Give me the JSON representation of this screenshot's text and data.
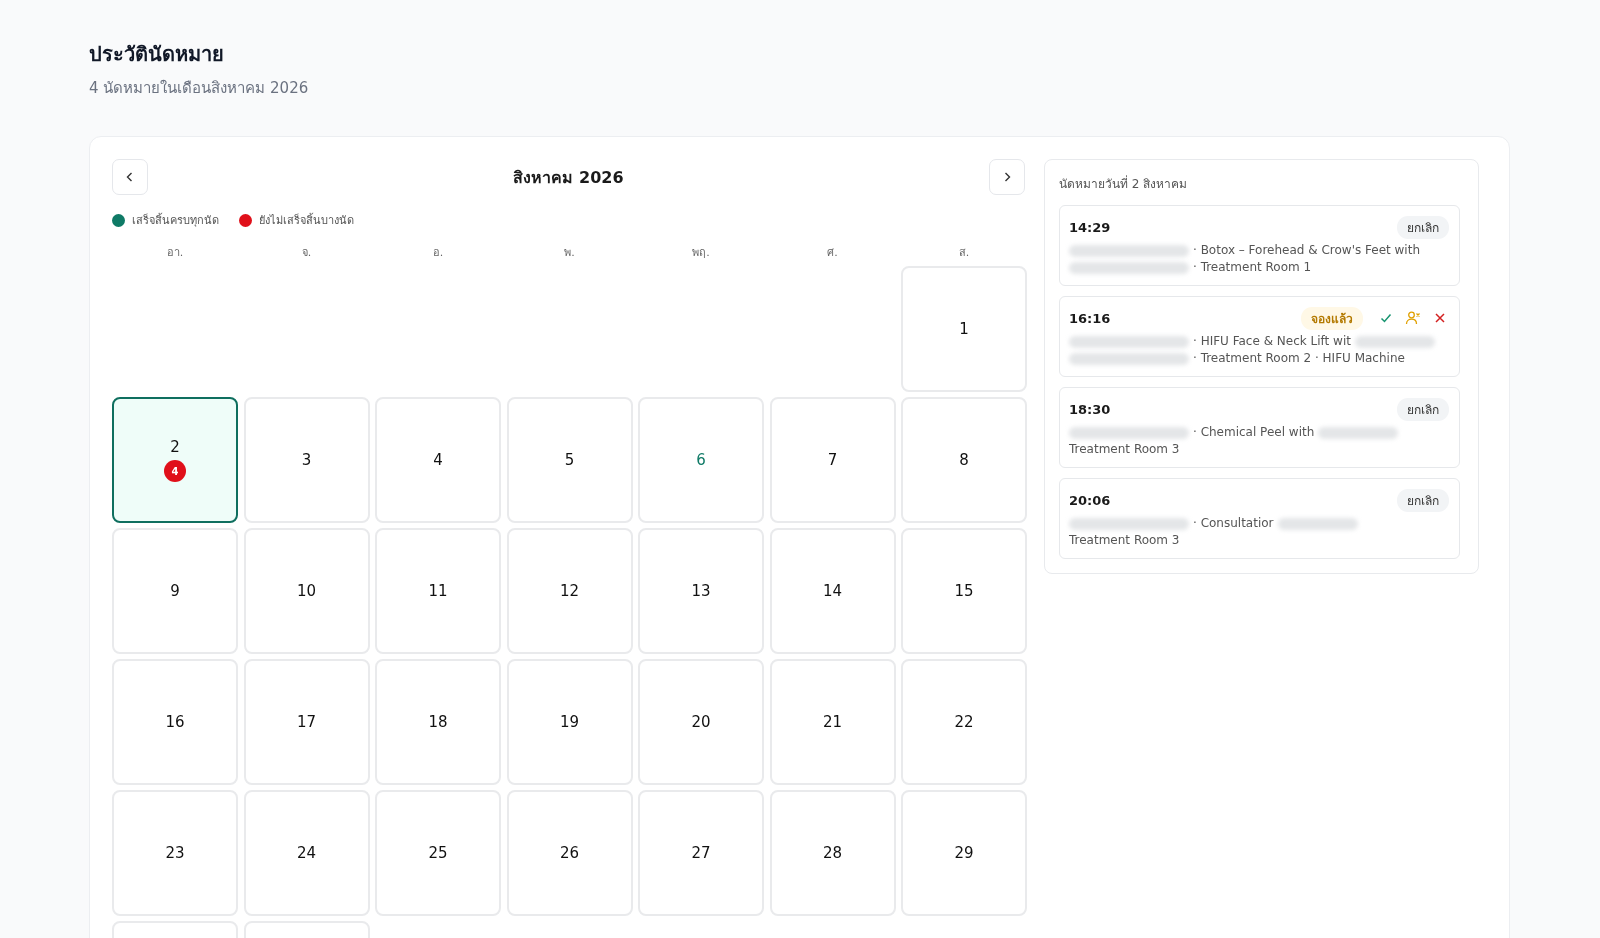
{
  "header": {
    "title": "ประวัตินัดหมาย",
    "subtitle": "4 นัดหมายในเดือนสิงหาคม 2026"
  },
  "calendar": {
    "month": "สิงหาคม 2026",
    "legend": [
      {
        "label": "เสร็จสิ้นครบทุกนัด",
        "color": "#0f7a66"
      },
      {
        "label": "ยังไม่เสร็จสิ้นบางนัด",
        "color": "#e0101a"
      }
    ],
    "weekdays": [
      "อา.",
      "จ.",
      "อ.",
      "พ.",
      "พฤ.",
      "ศ.",
      "ส."
    ],
    "cells": [
      {
        "kind": "blank"
      },
      {
        "kind": "blank"
      },
      {
        "kind": "blank"
      },
      {
        "kind": "blank"
      },
      {
        "kind": "blank"
      },
      {
        "kind": "blank"
      },
      {
        "kind": "day",
        "label": "1",
        "selected": false,
        "today": false
      },
      {
        "kind": "day",
        "label": "2",
        "selected": true,
        "today": false,
        "badge": "4",
        "color": "#e0101a"
      },
      {
        "kind": "day",
        "label": "3",
        "selected": false,
        "today": false
      },
      {
        "kind": "day",
        "label": "4",
        "selected": false,
        "today": false
      },
      {
        "kind": "day",
        "label": "5",
        "selected": false,
        "today": false
      },
      {
        "kind": "day",
        "label": "6",
        "selected": false,
        "today": true
      },
      {
        "kind": "day",
        "label": "7",
        "selected": false,
        "today": false
      },
      {
        "kind": "day",
        "label": "8",
        "selected": false,
        "today": false
      },
      {
        "kind": "day",
        "label": "9",
        "selected": false,
        "today": false
      },
      {
        "kind": "day",
        "label": "10",
        "selected": false,
        "today": false
      },
      {
        "kind": "day",
        "label": "11",
        "selected": false,
        "today": false
      },
      {
        "kind": "day",
        "label": "12",
        "selected": false,
        "today": false
      },
      {
        "kind": "day",
        "label": "13",
        "selected": false,
        "today": false
      },
      {
        "kind": "day",
        "label": "14",
        "selected": false,
        "today": false
      },
      {
        "kind": "day",
        "label": "15",
        "selected": false,
        "today": false
      },
      {
        "kind": "day",
        "label": "16",
        "selected": false,
        "today": false
      },
      {
        "kind": "day",
        "label": "17",
        "selected": false,
        "today": false
      },
      {
        "kind": "day",
        "label": "18",
        "selected": false,
        "today": false
      },
      {
        "kind": "day",
        "label": "19",
        "selected": false,
        "today": false
      },
      {
        "kind": "day",
        "label": "20",
        "selected": false,
        "today": false
      },
      {
        "kind": "day",
        "label": "21",
        "selected": false,
        "today": false
      },
      {
        "kind": "day",
        "label": "22",
        "selected": false,
        "today": false
      },
      {
        "kind": "day",
        "label": "23",
        "selected": false,
        "today": false
      },
      {
        "kind": "day",
        "label": "24",
        "selected": false,
        "today": false
      },
      {
        "kind": "day",
        "label": "25",
        "selected": false,
        "today": false
      },
      {
        "kind": "day",
        "label": "26",
        "selected": false,
        "today": false
      },
      {
        "kind": "day",
        "label": "27",
        "selected": false,
        "today": false
      },
      {
        "kind": "day",
        "label": "28",
        "selected": false,
        "today": false
      },
      {
        "kind": "day",
        "label": "29",
        "selected": false,
        "today": false
      },
      {
        "kind": "cut"
      },
      {
        "kind": "cut"
      }
    ]
  },
  "day_panel": {
    "title": "นัดหมายวันที่ 2 สิงหาคม",
    "appointments": [
      {
        "time": "14:29",
        "kind": "cancelled",
        "status": "ยกเลิก",
        "lines": [
          [
            {
              "kind": "blur"
            },
            {
              "kind": "text",
              "text": "· Botox – Forehead & Crow's Feet with"
            }
          ],
          [
            {
              "kind": "blur"
            },
            {
              "kind": "text",
              "text": "· Treatment Room 1"
            }
          ]
        ]
      },
      {
        "time": "16:16",
        "kind": "booked",
        "status": "จองแล้ว",
        "lines": [
          [
            {
              "kind": "blur"
            },
            {
              "kind": "text",
              "text": "· HIFU Face & Neck Lift wit"
            },
            {
              "kind": "blur"
            }
          ],
          [
            {
              "kind": "blur"
            },
            {
              "kind": "text",
              "text": "· Treatment Room 2 · HIFU Machine"
            }
          ]
        ]
      },
      {
        "time": "18:30",
        "kind": "cancelled",
        "status": "ยกเลิก",
        "lines": [
          [
            {
              "kind": "blur"
            },
            {
              "kind": "text",
              "text": "· Chemical Peel with"
            },
            {
              "kind": "blur"
            }
          ],
          [
            {
              "kind": "text",
              "text": "Treatment Room 3"
            }
          ]
        ]
      },
      {
        "time": "20:06",
        "kind": "cancelled",
        "status": "ยกเลิก",
        "lines": [
          [
            {
              "kind": "blur"
            },
            {
              "kind": "text",
              "text": "· Consultatior"
            },
            {
              "kind": "blur"
            }
          ],
          [
            {
              "kind": "text",
              "text": "Treatment Room 3"
            }
          ]
        ]
      }
    ]
  }
}
